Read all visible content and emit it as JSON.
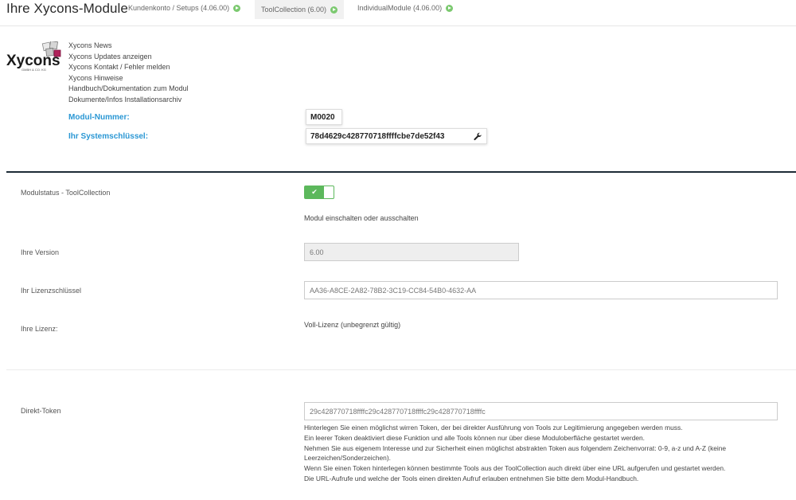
{
  "header": {
    "title": "Ihre Xycons-Module",
    "tabs": [
      {
        "label": "Kundenkonto / Setups (4.06.00)",
        "active": false
      },
      {
        "label": "ToolCollection (6.00)",
        "active": true
      },
      {
        "label": "IndividualModule (4.06.00)",
        "active": false
      }
    ]
  },
  "logo": {
    "text": "Xycons",
    "subtext": "GMBH & CO. KG"
  },
  "links": [
    "Xycons News",
    "Xycons Updates anzeigen",
    "Xycons Kontakt / Fehler melden",
    "Xycons Hinweise",
    "Handbuch/Dokumentation zum Modul",
    "Dokumente/Infos Installationsarchiv"
  ],
  "module": {
    "number_label": "Modul-Nummer:",
    "number_value": "M0020",
    "key_label": "Ihr Systemschlüssel:",
    "key_value": "78d4629c428770718ffffcbe7de52f43",
    "key_icon": "wrench-icon"
  },
  "status": {
    "label": "Modulstatus - ToolCollection",
    "enabled": true,
    "toggle_glyph": "✔",
    "help": "Modul einschalten oder ausschalten"
  },
  "version": {
    "label": "Ihre Version",
    "value": "6.00"
  },
  "license_key": {
    "label": "Ihr Lizenzschlüssel",
    "value": "AA36-A8CE-2A82-78B2-3C19-CC84-54B0-4632-AA"
  },
  "license": {
    "label": "Ihre Lizenz:",
    "value": "Voll-Lizenz (unbegrenzt gültig)"
  },
  "token": {
    "label": "Direkt-Token",
    "value": "29c428770718ffffc29c428770718ffffc29c428770718ffffc",
    "help_lines": [
      "Hinterlegen Sie einen möglichst wirren Token, der bei direkter Ausführung von Tools zur Legitimierung angegeben werden muss.",
      "Ein leerer Token deaktiviert diese Funktion und alle Tools können nur über diese Moduloberfläche gestartet werden.",
      "Nehmen Sie aus eigenem Interesse und zur Sicherheit einen möglichst abstrakten Token aus folgendem Zeichenvorrat: 0-9, a-z und A-Z (keine",
      "Leerzeichen/Sonderzeichen).",
      "Wenn Sie einen Token hinterlegen können bestimmte Tools aus der ToolCollection auch direkt über eine URL aufgerufen und gestartet werden.",
      "Die URL-Aufrufe und welche der Tools einen direkten Aufruf erlauben entnehmen Sie bitte dem Modul-Handbuch."
    ]
  },
  "colors": {
    "accent_blue": "#2a97d4",
    "toggle_green": "#5cb85c",
    "tab_dot_green": "#7bc96f",
    "divider_dark": "#1d2b36"
  }
}
